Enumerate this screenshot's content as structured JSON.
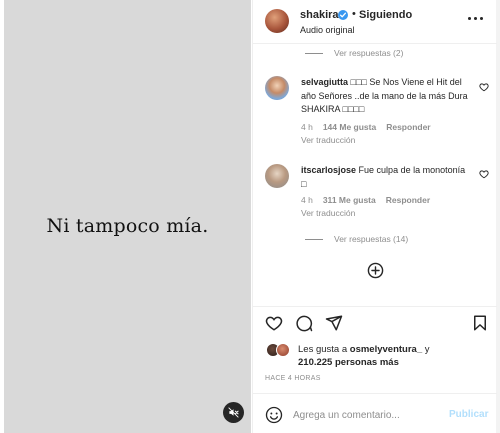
{
  "media": {
    "caption_text": "Ni tampoco mía.",
    "mute_icon": "speaker-muted-icon"
  },
  "header": {
    "username": "shakira",
    "separator": "•",
    "follow_status": "Siguiendo",
    "audio_label": "Audio original",
    "more_icon": "more-horizontal-icon"
  },
  "comments": {
    "view_replies_top": "Ver respuestas (2)",
    "items": [
      {
        "username": "selvagiutta",
        "text": "□□□ Se Nos Viene el Hit del año Señores ..de la mano de la más Dura SHAKIRA □□□□",
        "time": "4 h",
        "likes": "144 Me gusta",
        "reply": "Responder",
        "translate": "Ver traducción"
      },
      {
        "username": "itscarlosjose",
        "text": "Fue culpa de la monotonía □",
        "time": "4 h",
        "likes": "311 Me gusta",
        "reply": "Responder",
        "translate": "Ver traducción",
        "view_replies": "Ver respuestas (14)"
      }
    ],
    "load_more_icon": "plus-circle-icon"
  },
  "actions": {
    "like_icon": "heart-icon",
    "comment_icon": "comment-icon",
    "share_icon": "paper-plane-icon",
    "save_icon": "bookmark-icon"
  },
  "likes": {
    "prefix": "Les gusta a ",
    "user": "osmelyventura_",
    "middle": " y",
    "count": "210.225 personas más"
  },
  "posted": "HACE 4 HORAS",
  "add_comment": {
    "emoji_icon": "smiley-icon",
    "placeholder": "Agrega un comentario...",
    "publish_label": "Publicar"
  },
  "colors": {
    "media_bg": "#d9d9d9",
    "verified": "#3897f0",
    "muted_text": "#8e8e8e",
    "publish_disabled": "#b2dffc"
  }
}
